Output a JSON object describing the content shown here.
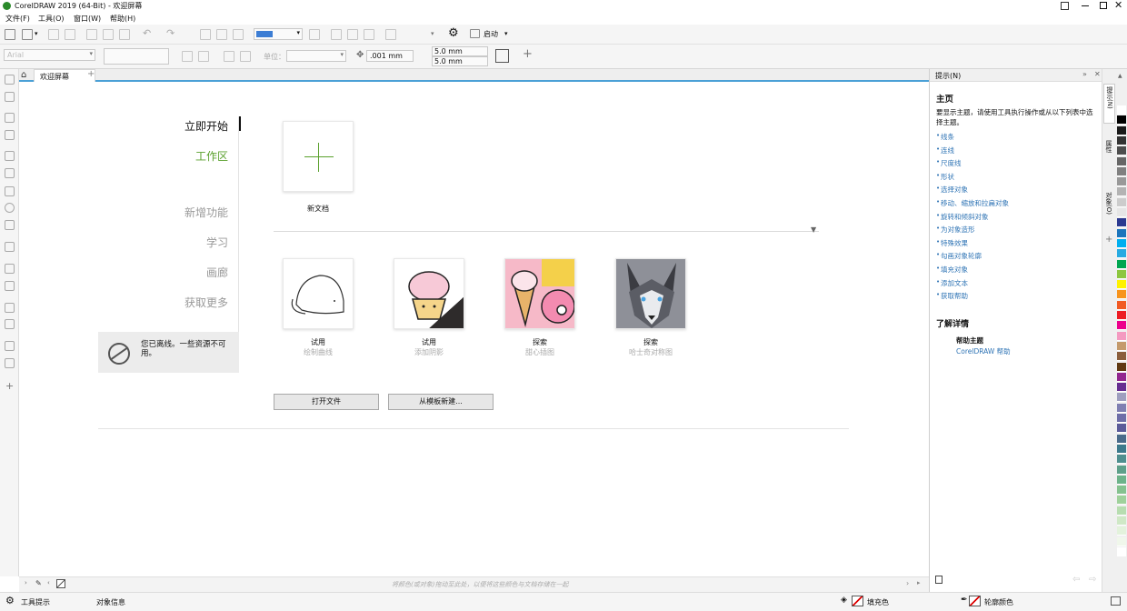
{
  "window": {
    "title": "CorelDRAW 2019 (64-Bit) - 欢迎屏幕"
  },
  "menu": [
    "文件(F)",
    "工具(O)",
    "窗口(W)",
    "帮助(H)"
  ],
  "toolbar": {
    "zoom_fill_color": "#3c7dd4",
    "launch_label": "启动"
  },
  "propbar": {
    "font_placeholder": "Arial",
    "units_label": "单位：",
    "nudge": ".001 mm",
    "dup_x": "5.0 mm",
    "dup_y": "5.0 mm"
  },
  "tabs": {
    "welcome": "欢迎屏幕"
  },
  "nav": {
    "start": "立即开始",
    "workspace": "工作区",
    "whatsnew": "新增功能",
    "learn": "学习",
    "gallery": "画廊",
    "getmore": "获取更多",
    "offline": "您已离线。一些资源不可用。"
  },
  "main": {
    "new_doc": "新文档",
    "cards": [
      {
        "title": "试用",
        "subtitle": "绘制曲线"
      },
      {
        "title": "试用",
        "subtitle": "添加阴影"
      },
      {
        "title": "探索",
        "subtitle": "甜心插图"
      },
      {
        "title": "探索",
        "subtitle": "哈士奇对称图"
      }
    ],
    "open_button": "打开文件",
    "template_button": "从模板新建..."
  },
  "hint_bar": "将颜色(或对象)拖动至此处，以便将这些颜色与文档存储在一起",
  "docker": {
    "title": "提示(N)",
    "heading": "主页",
    "intro": "要显示主题，请使用工具执行操作或从以下列表中选择主题。",
    "links": [
      "线条",
      "连线",
      "尺度线",
      "形状",
      "选择对象",
      "移动、缩放和拉扁对象",
      "旋转和倾斜对象",
      "为对象造形",
      "特殊效果",
      "勾画对象轮廓",
      "填充对象",
      "添加文本",
      "获取帮助"
    ],
    "learn_more": "了解详情",
    "help_topics": "帮助主题",
    "help_link": "CorelDRAW 帮助",
    "vtabs": [
      "提示(N)",
      "属性",
      "对象(O)"
    ]
  },
  "status": {
    "tool_hints": "工具提示",
    "object_info": "对象信息",
    "fill": "填充色",
    "outline": "轮廓颜色"
  },
  "palette": [
    "#ffffff",
    "#000000",
    "#1a1a1a",
    "#333333",
    "#4d4d4d",
    "#666666",
    "#808080",
    "#999999",
    "#b3b3b3",
    "#cccccc",
    "#e6e6e6",
    "#2b3990",
    "#1c75bc",
    "#00aeef",
    "#27aae1",
    "#00a651",
    "#8dc63f",
    "#fff200",
    "#f7941d",
    "#f15a24",
    "#ed1c24",
    "#ec008c",
    "#f49ac1",
    "#c49a6c",
    "#8b5e3c",
    "#603913",
    "#92278f",
    "#662d91",
    "#9e9ebf",
    "#7f7fb2",
    "#6e6ea8",
    "#5b5b99",
    "#4a6b8a",
    "#3d7a8c",
    "#4f8f8f",
    "#5ea08a",
    "#6db38a",
    "#85c28f",
    "#9fd19b",
    "#b7ddb0",
    "#cfe8c6",
    "#e3f2dc",
    "#f0f7eb",
    "#ffffff"
  ]
}
